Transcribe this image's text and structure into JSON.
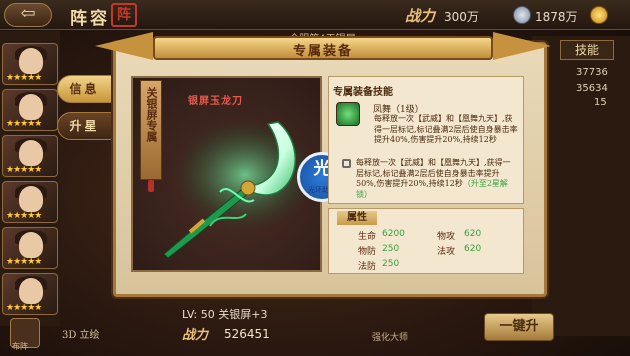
{
  "topbar": {
    "back_symbol": "⇦",
    "title": "阵容",
    "seal": "阵",
    "power_label": "战力",
    "power_value": "300万",
    "silver_value": "1878万",
    "banner": "全服第4天银屏"
  },
  "sidebar": {
    "lineup_label": "布阵",
    "stars": [
      "★★★★★",
      "★★★★★",
      "★★★★★",
      "★★★★★",
      "★★★★★",
      "★★★★★"
    ]
  },
  "right_panel": {
    "skill_tab": "技能",
    "stats": [
      "37736",
      "35634",
      "15"
    ],
    "onekey_label": "一键升"
  },
  "bottom": {
    "btn_3d": "3D 立绘",
    "lv_text": "LV: 50  关银屏+3",
    "power_label": "战力",
    "power_value": "526451",
    "master_label": "强化大师"
  },
  "tabs": {
    "info": "信息",
    "upstar": "升星"
  },
  "dialog": {
    "title": "专属装备",
    "weapon_name": "银屏玉龙刀",
    "vertical_tag": "关银屏专属",
    "watermark_char": "光",
    "watermark_sub": "光环助手",
    "skill_header": "专属装备技能",
    "skill_name": "凤舞（1级）",
    "desc1": "每释放一次【武威】和【凰舞九天】,获得一层标记,标记叠满2层后使自身暴击率提升40%,伤害提升20%,持续12秒",
    "desc2": "每释放一次【武威】和【凰舞九天】,获得一层标记,标记叠满2层后使自身暴击率提升50%,伤害提升20%,持续12秒",
    "desc2_extra": "（升至2星解锁）",
    "attr_header": "属性",
    "attributes": [
      {
        "label": "生命",
        "value": "6200"
      },
      {
        "label": "物攻",
        "value": "620"
      },
      {
        "label": "物防",
        "value": "250"
      },
      {
        "label": "法攻",
        "value": "620"
      },
      {
        "label": "法防",
        "value": "250"
      }
    ]
  },
  "colors": {
    "accent_gold": "#c7923e",
    "highlight_red": "#c0392b",
    "stat_green": "#3aa040"
  }
}
